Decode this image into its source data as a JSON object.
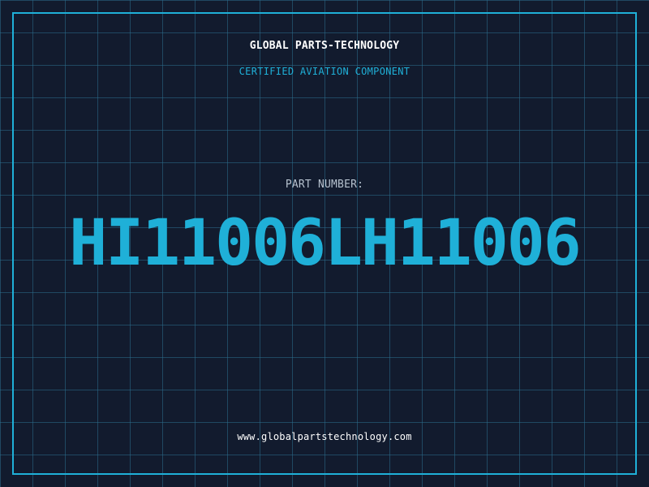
{
  "header": {
    "company_name": "GLOBAL PARTS-TECHNOLOGY",
    "subtitle": "CERTIFIED AVIATION COMPONENT"
  },
  "part": {
    "label": "PART NUMBER:",
    "number": "HI11006LH11006"
  },
  "footer": {
    "website": "www.globalpartstechnology.com"
  },
  "colors": {
    "background": "#121b2e",
    "accent": "#1fb0d8",
    "grid": "#2c6e8c",
    "text_primary": "#ffffff",
    "text_muted": "#b6c2cf"
  }
}
